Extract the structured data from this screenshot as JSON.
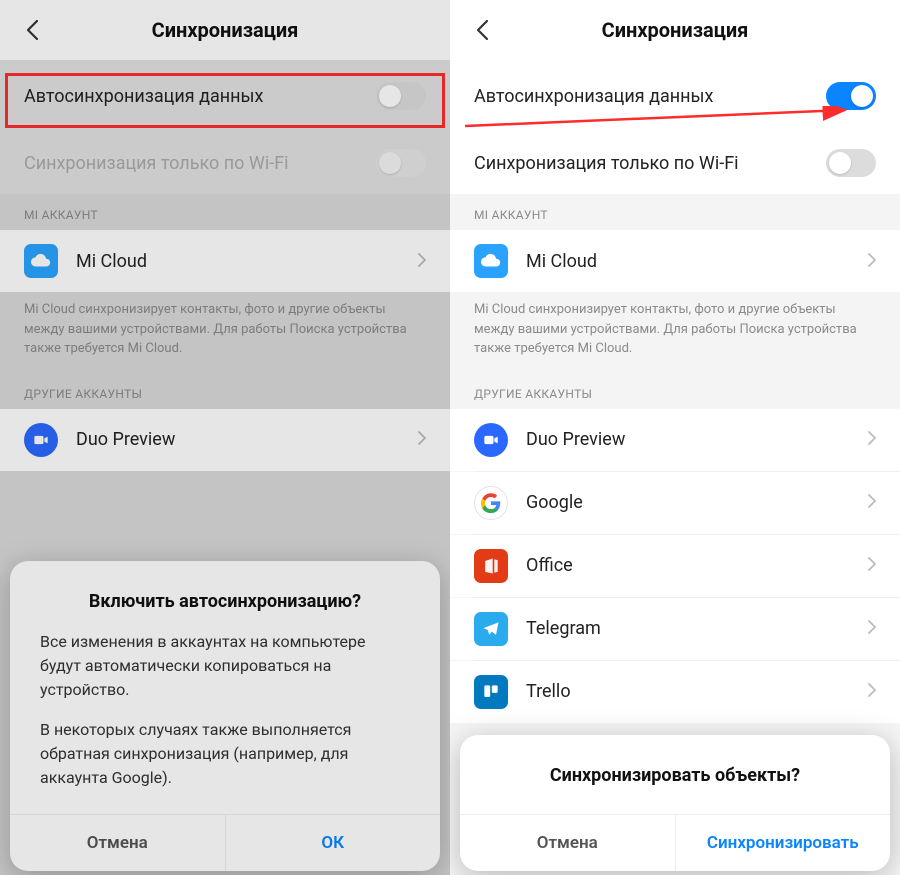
{
  "left": {
    "header_title": "Синхронизация",
    "autosync_label": "Автосинхронизация данных",
    "wifi_only_label": "Синхронизация только по Wi-Fi",
    "section_mi": "MI АККАУНТ",
    "mi_cloud": "Mi Cloud",
    "mi_cloud_desc": "Mi Cloud синхронизирует контакты, фото и другие объекты между вашими устройствами. Для работы Поиска устройства также требуется Mi Cloud.",
    "section_other": "ДРУГИЕ АККАУНТЫ",
    "accounts": {
      "duo": "Duo Preview"
    },
    "dialog": {
      "title": "Включить автосинхронизацию?",
      "p1": "Все изменения в аккаунтах на компьютере будут автоматически копироваться на устройство.",
      "p2": "В некоторых случаях также выполняется обратная синхронизация (например, для аккаунта Google).",
      "cancel": "Отмена",
      "ok": "ОК"
    }
  },
  "right": {
    "header_title": "Синхронизация",
    "autosync_label": "Автосинхронизация данных",
    "wifi_only_label": "Синхронизация только по Wi-Fi",
    "section_mi": "MI АККАУНТ",
    "mi_cloud": "Mi Cloud",
    "mi_cloud_desc": "Mi Cloud синхронизирует контакты, фото и другие объекты между вашими устройствами. Для работы Поиска устройства также требуется Mi Cloud.",
    "section_other": "ДРУГИЕ АККАУНТЫ",
    "accounts": {
      "duo": "Duo Preview",
      "google": "Google",
      "office": "Office",
      "telegram": "Telegram",
      "trello": "Trello"
    },
    "dialog": {
      "title": "Синхронизировать объекты?",
      "cancel": "Отмена",
      "confirm": "Синхронизировать"
    }
  }
}
